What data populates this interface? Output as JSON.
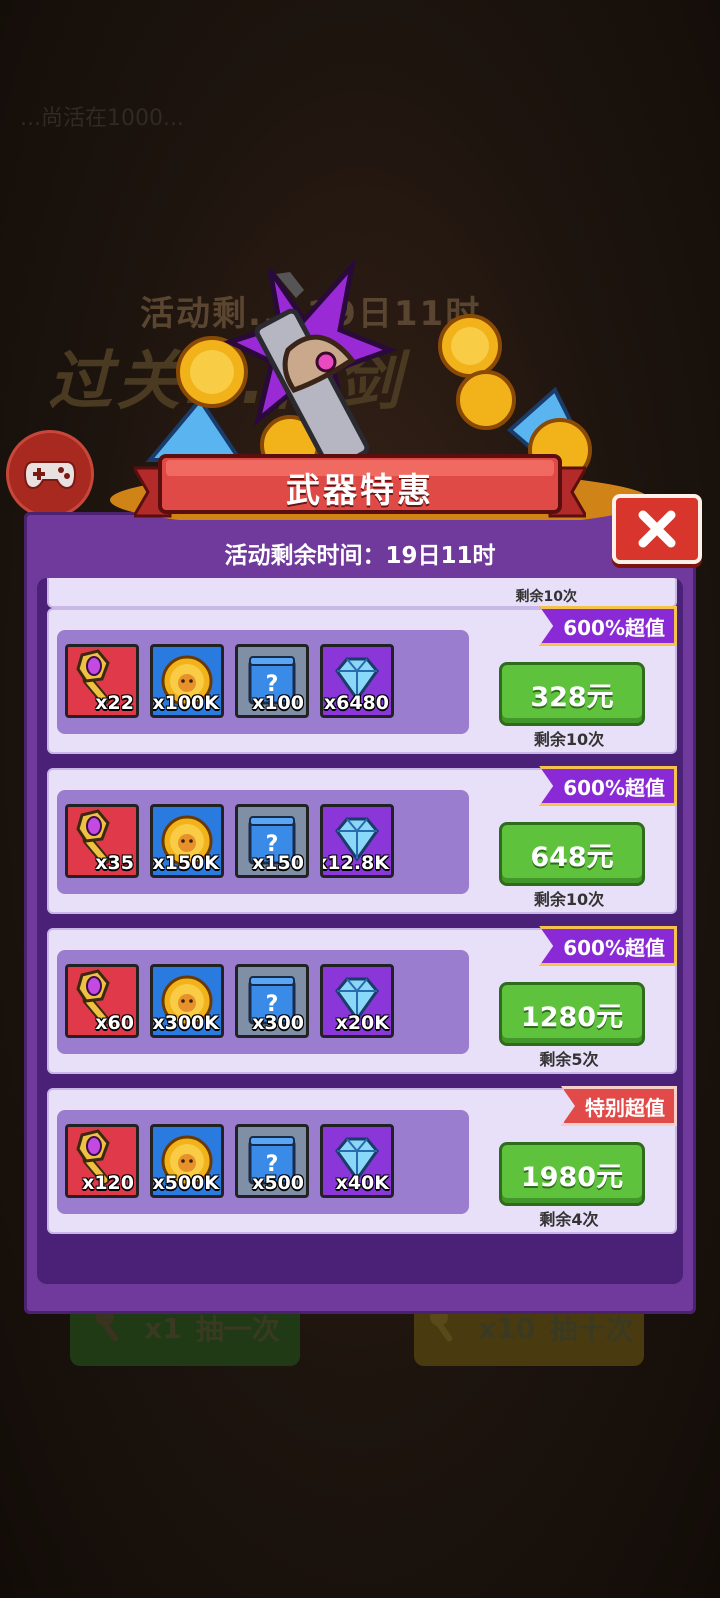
{
  "background": {
    "top_text": "...尚活在1000...",
    "banner_time": "活动剩... 19日11时",
    "banner_title": "过关...神剑",
    "draw_one": {
      "count": "x1",
      "label": "抽一次"
    },
    "draw_ten": {
      "count": "x10",
      "label": "抽十次"
    }
  },
  "dialog": {
    "title": "武器特惠",
    "timer": "活动剩余时间：19日11时",
    "partial_remaining": "剩余10次",
    "offers": [
      {
        "badge": "600%超值",
        "badge_style": "purple",
        "items": [
          "x22",
          "x100K",
          "x100",
          "x6480"
        ],
        "price": "328元",
        "remaining": "剩余10次"
      },
      {
        "badge": "600%超值",
        "badge_style": "purple",
        "items": [
          "x35",
          "x150K",
          "x150",
          "x12.8K"
        ],
        "price": "648元",
        "remaining": "剩余10次"
      },
      {
        "badge": "600%超值",
        "badge_style": "purple",
        "items": [
          "x60",
          "x300K",
          "x300",
          "x20K"
        ],
        "price": "1280元",
        "remaining": "剩余5次"
      },
      {
        "badge": "特别超值",
        "badge_style": "red",
        "items": [
          "x120",
          "x500K",
          "x500",
          "x40K"
        ],
        "price": "1980元",
        "remaining": "剩余4次"
      }
    ],
    "item_types": [
      "staff-shard-icon",
      "gold-coin-icon",
      "mystery-scroll-icon",
      "diamond-icon"
    ]
  },
  "colors": {
    "dialog_bg": "#6f3a9c",
    "buy_green": "#5fc23c",
    "badge_purple": "#8a2ad6",
    "badge_red": "#e24a4a"
  }
}
